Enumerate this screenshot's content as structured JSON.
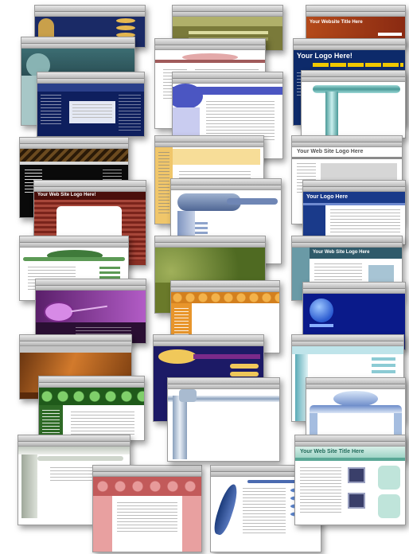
{
  "collage": {
    "logos": {
      "website_title": "Your Website Title Here",
      "logo_here_1": "Your Logo Here!",
      "web_site_logo_1": "Your Web Site Logo Here!",
      "web_site_logo_2": "Your Web Site Logo Here",
      "logo_here_2": "Your Logo Here",
      "web_site_logo_3": "Your Web Site Logo Here",
      "web_site_title": "Your Web Site Title Here"
    }
  }
}
